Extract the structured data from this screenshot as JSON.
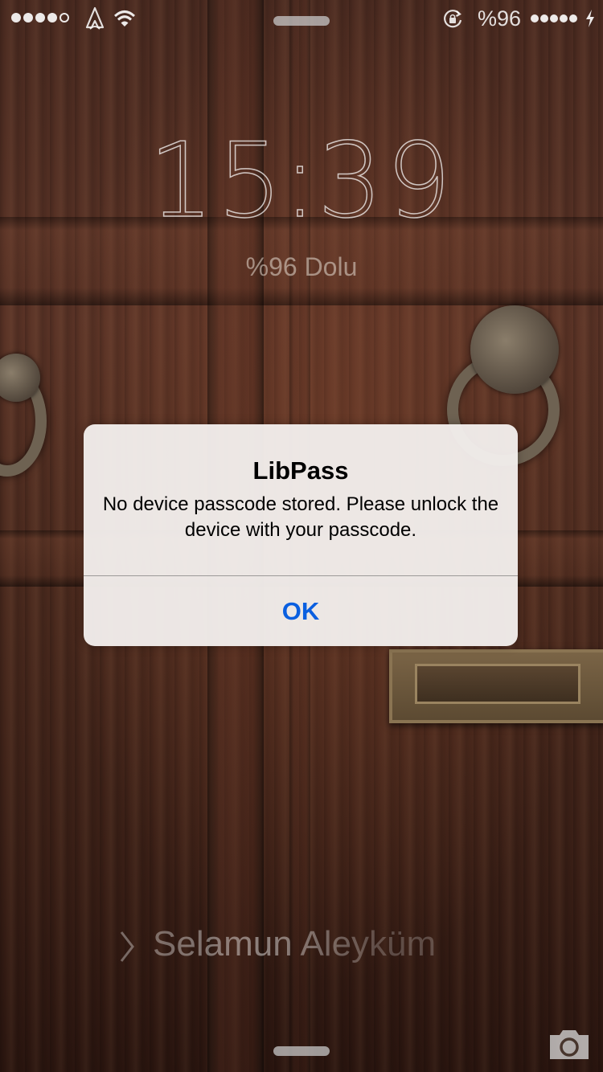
{
  "status_bar": {
    "signal_dots_filled": 4,
    "signal_dots_total": 5,
    "carrier_icon": "custom-carrier-icon",
    "wifi_icon": "wifi-icon",
    "rotation_lock_icon": "rotation-lock-icon",
    "battery_text": "%96",
    "battery_dots_filled": 5,
    "charge_icon": "charging-bolt-icon"
  },
  "lock_screen": {
    "time_hours": "15",
    "time_separator": ":",
    "time_minutes": "39",
    "battery_status": "%96 Dolu",
    "slide_to_unlock": "Selamun Aleyküm"
  },
  "alert": {
    "title": "LibPass",
    "message": "No device passcode stored. Please unlock the device with your passcode.",
    "ok_label": "OK"
  },
  "colors": {
    "alert_button": "#0a5fe0",
    "alert_background": "#f2eeec"
  },
  "icons": {
    "camera": "camera-icon",
    "unlock_chevron": "chevron-right-icon"
  }
}
